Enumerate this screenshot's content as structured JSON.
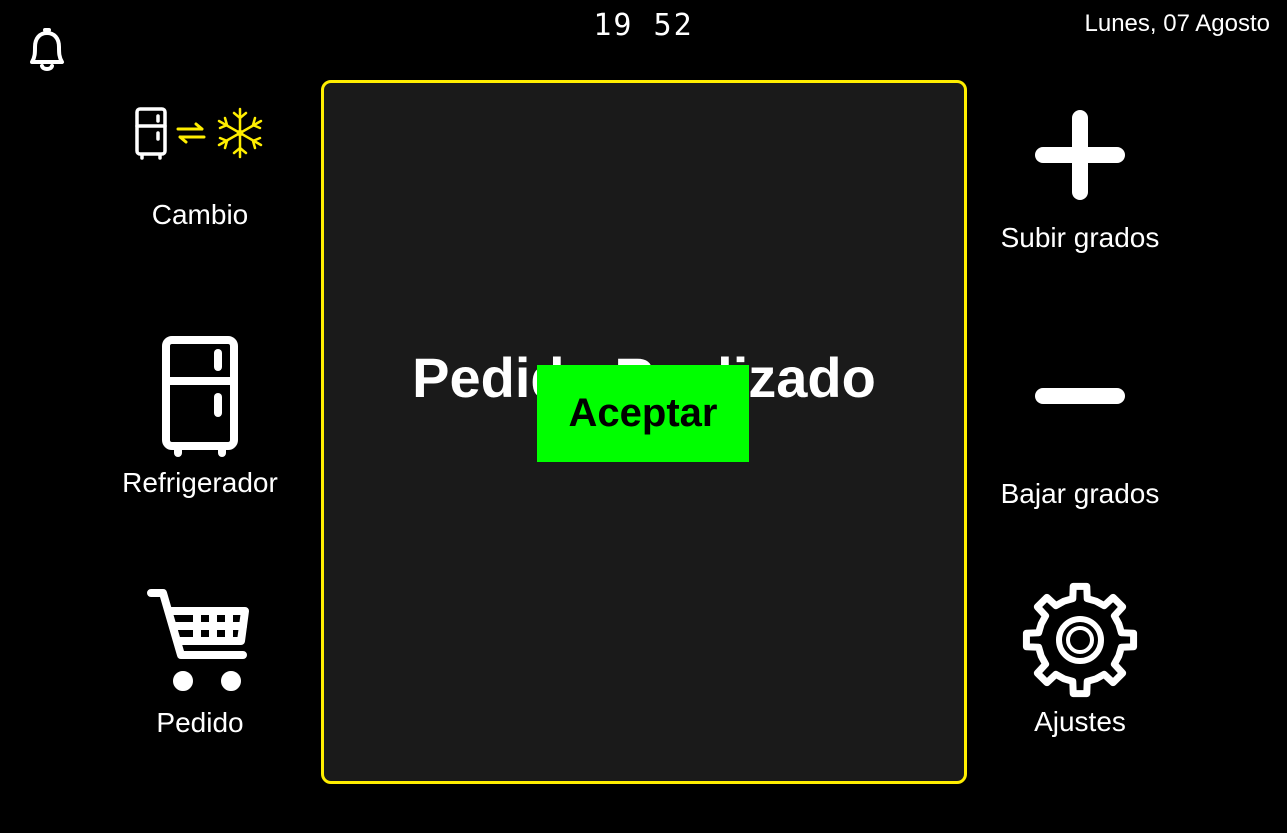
{
  "header": {
    "clock": "19 52",
    "date": "Lunes, 07 Agosto",
    "notification_icon": "bell-icon"
  },
  "left_menu": {
    "cambio": {
      "label": "Cambio",
      "icons": [
        "fridge-icon",
        "swap-arrows-icon",
        "snowflake-icon"
      ]
    },
    "refrigerador": {
      "label": "Refrigerador",
      "icon": "fridge-icon"
    },
    "pedido": {
      "label": "Pedido",
      "icon": "cart-icon"
    }
  },
  "right_menu": {
    "subir": {
      "label": "Subir grados",
      "icon": "plus-icon"
    },
    "bajar": {
      "label": "Bajar grados",
      "icon": "minus-icon"
    },
    "ajustes": {
      "label": "Ajustes",
      "icon": "gear-icon"
    }
  },
  "dialog": {
    "title": "Pedido Realizado",
    "accept_label": "Aceptar"
  },
  "colors": {
    "background": "#000000",
    "panel": "#1a1a1a",
    "panel_border": "#ffee00",
    "accent_yellow": "#ffee00",
    "accept_button": "#00ff00"
  }
}
